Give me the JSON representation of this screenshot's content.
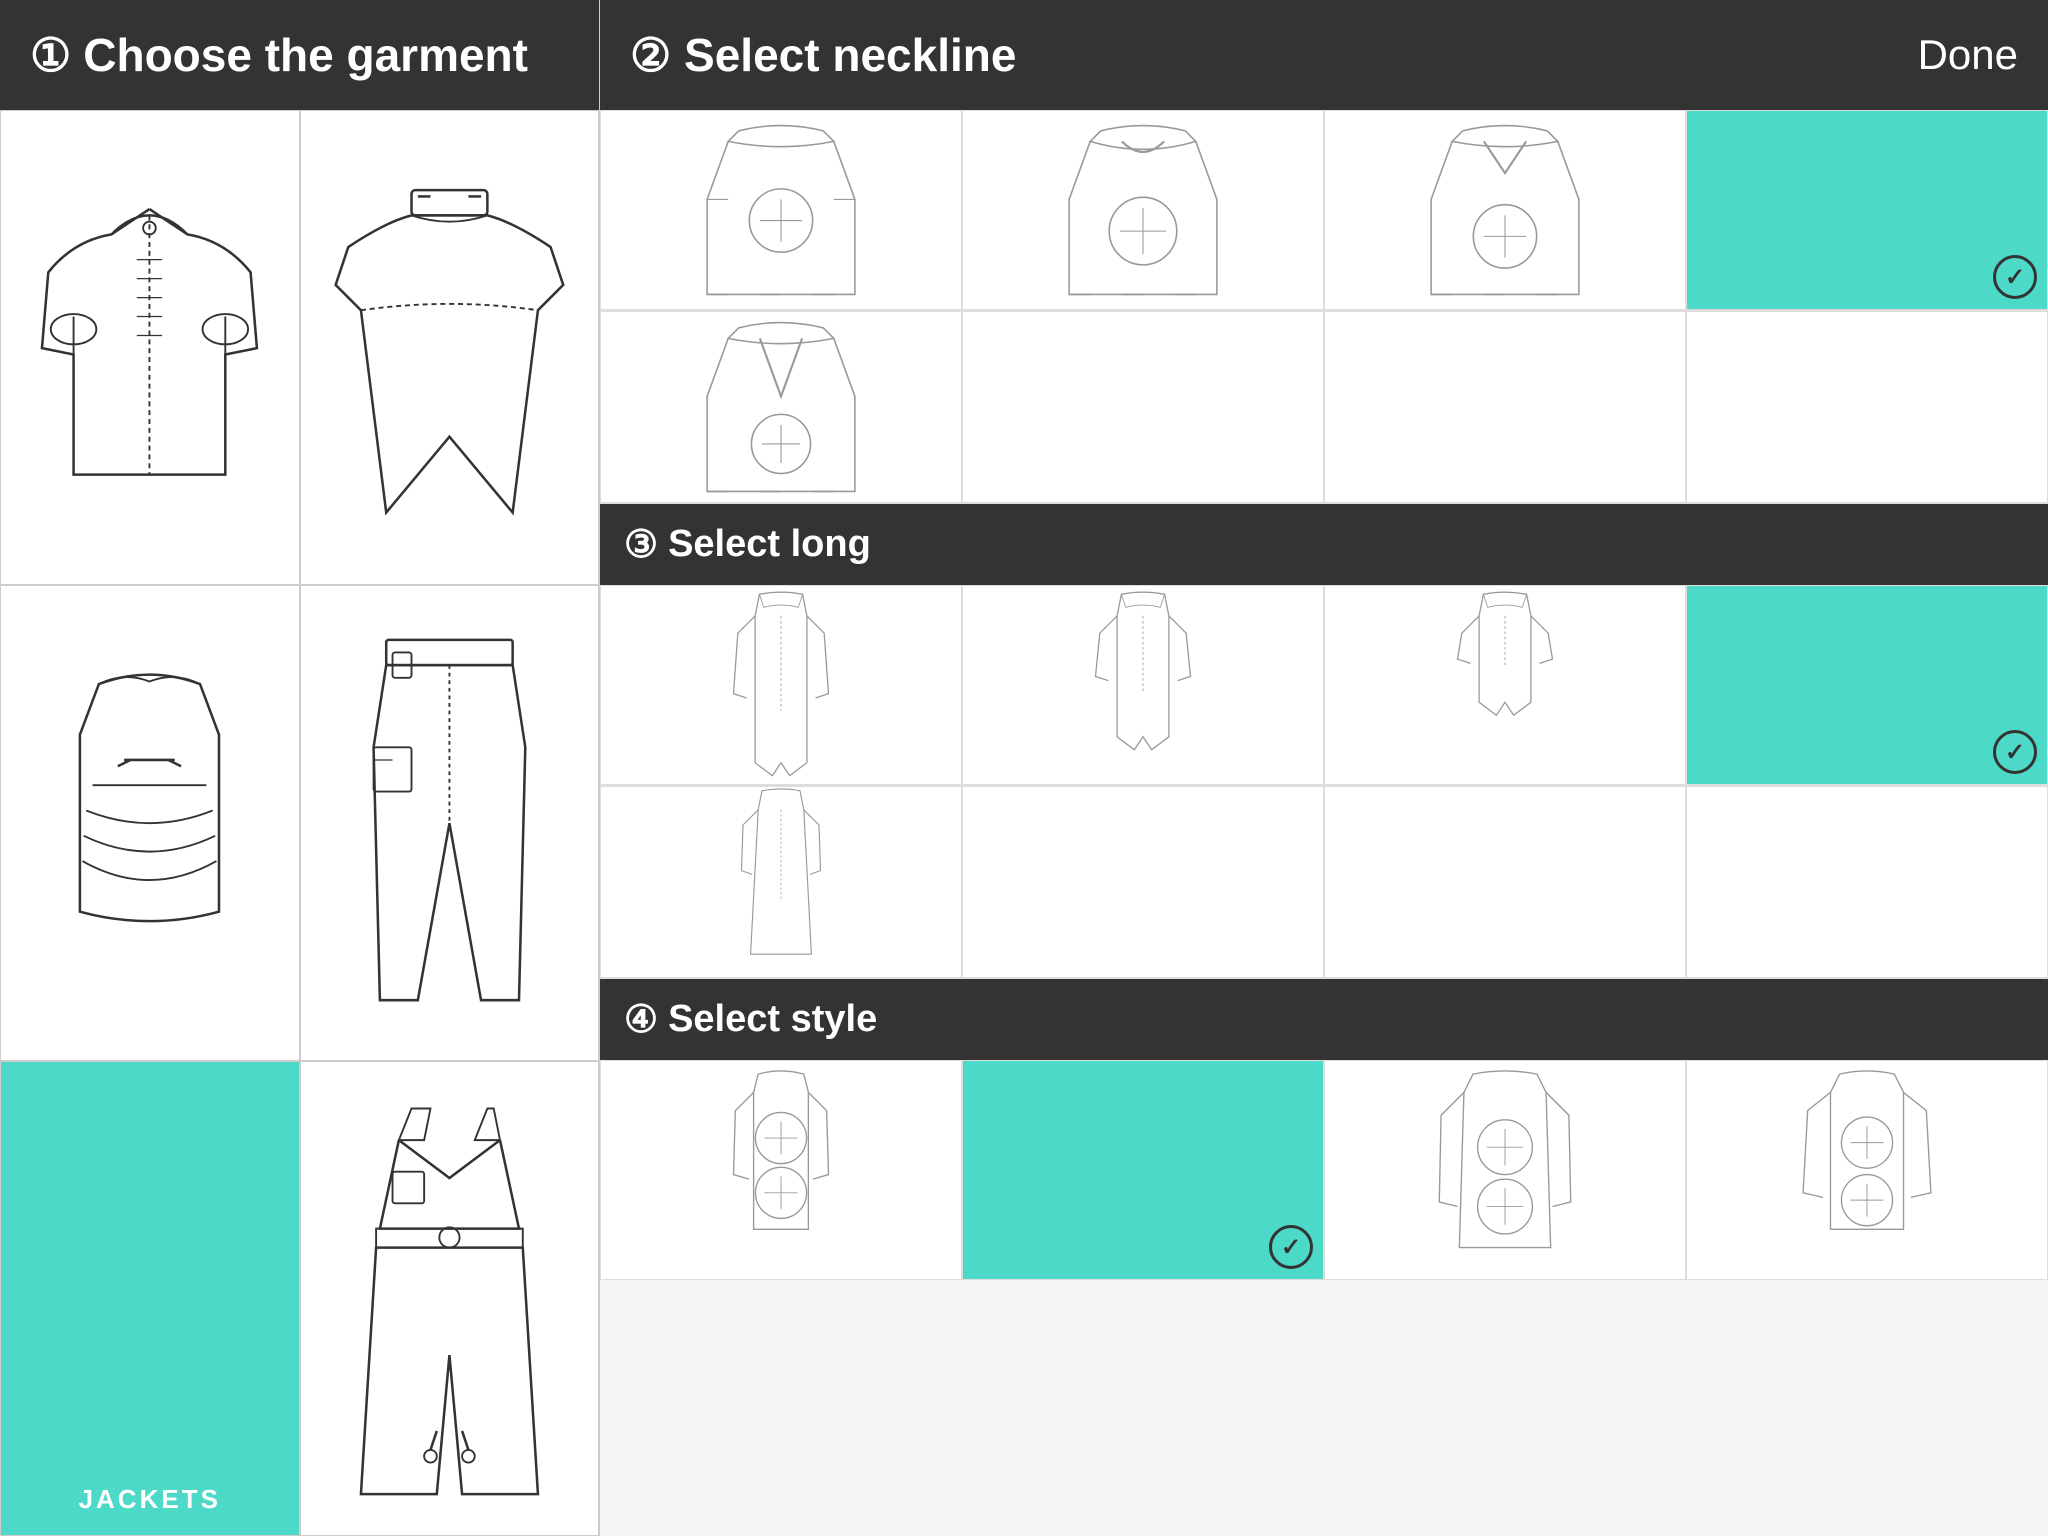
{
  "left_panel": {
    "header": {
      "step_num": "①",
      "title": "Choose the garment"
    },
    "garments": [
      {
        "id": "blouse",
        "label": "",
        "selected": false
      },
      {
        "id": "cape",
        "label": "",
        "selected": false
      },
      {
        "id": "bustier",
        "label": "",
        "selected": false
      },
      {
        "id": "trousers",
        "label": "",
        "selected": false
      },
      {
        "id": "jacket",
        "label": "JACKETS",
        "selected": true
      },
      {
        "id": "jumpsuit",
        "label": "",
        "selected": false
      }
    ]
  },
  "right_panel": {
    "header": {
      "step_num": "②",
      "title": "Select neckline",
      "done_label": "Done"
    },
    "sections": [
      {
        "id": "neckline",
        "step_num": "②",
        "title": "Select neckline"
      },
      {
        "id": "length",
        "step_num": "③",
        "title": "Select long"
      },
      {
        "id": "style",
        "step_num": "④",
        "title": "Select style"
      }
    ]
  },
  "colors": {
    "selected_bg": "#4dd9c8",
    "header_bg": "#333333",
    "border": "#cccccc"
  }
}
